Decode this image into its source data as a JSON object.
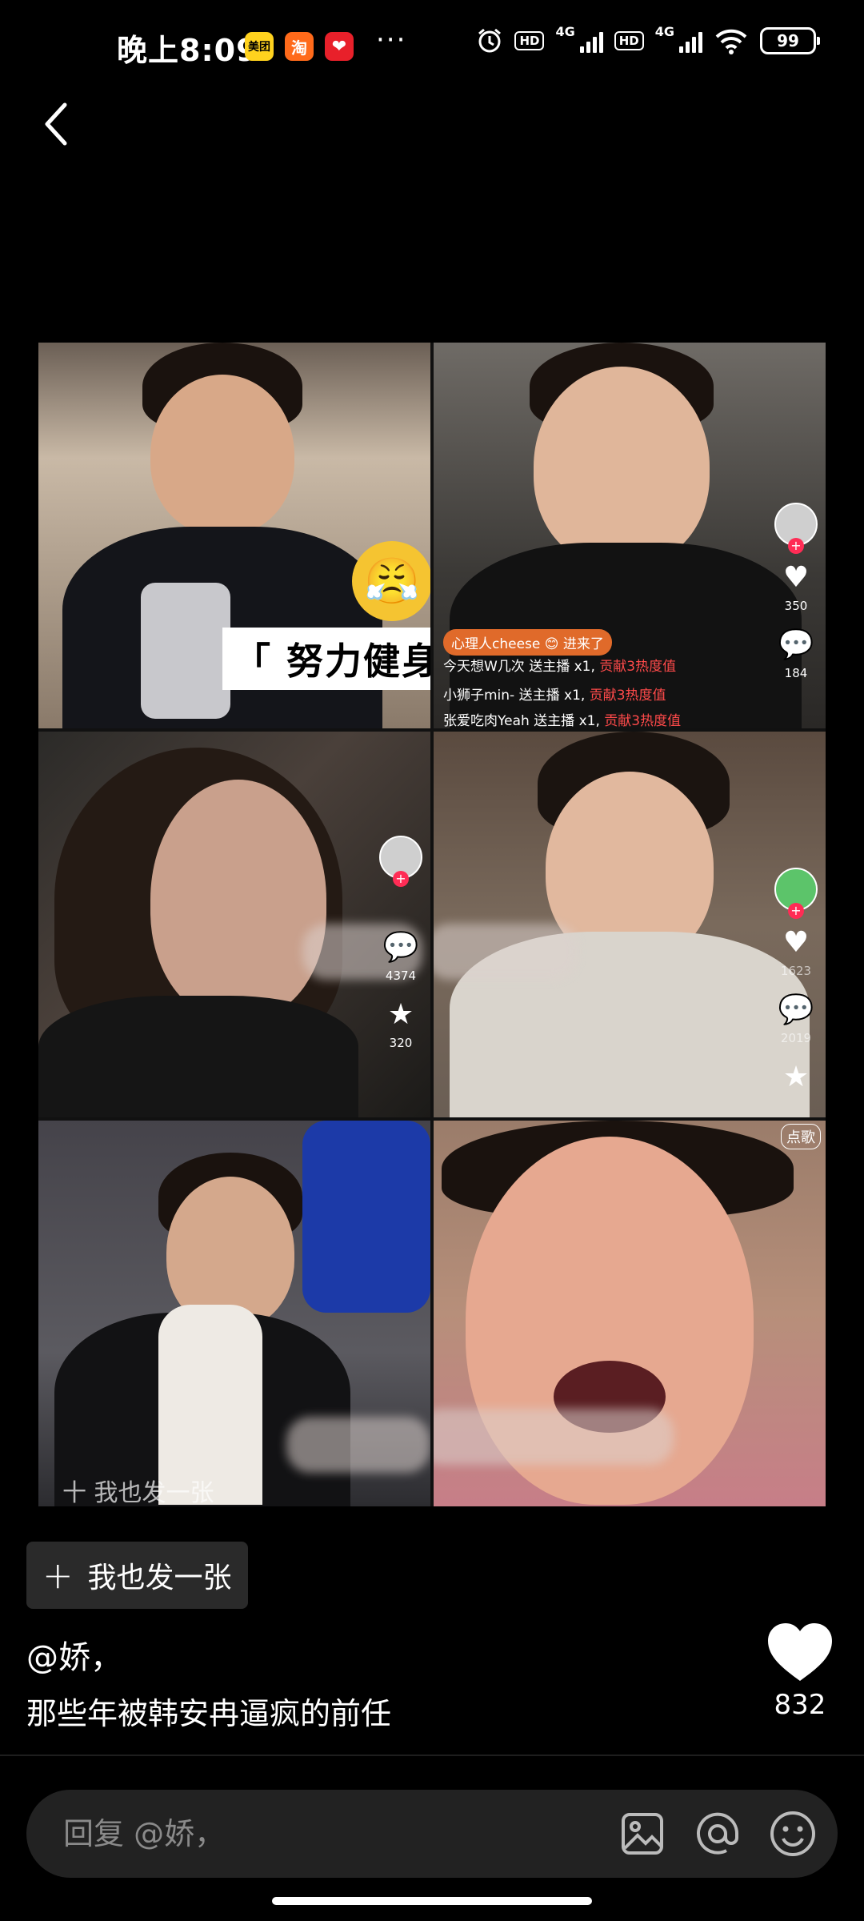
{
  "status_bar": {
    "time": "晚上8:09",
    "apps": [
      "美团",
      "淘",
      "❤"
    ],
    "more": "···",
    "hd_1": "HD",
    "net_1": "4G",
    "hd_2": "HD",
    "net_2": "4G",
    "battery": "99"
  },
  "header": {
    "back_icon": "chevron-left-icon"
  },
  "collage": {
    "tile1": {
      "caption": "「 努力健身 」",
      "emoji": "😤"
    },
    "tile2": {
      "join_text": "心理人cheese 😊 进来了",
      "comments": [
        {
          "user": "今天想W几次",
          "action": "送主播",
          "gift": "x1,",
          "contrib": "贡献3热度值"
        },
        {
          "user": "小狮子min-",
          "action": "送主播",
          "gift": "x1,",
          "contrib": "贡献3热度值"
        },
        {
          "user": "张爱吃肉Yeah",
          "action": "送主播",
          "gift": "x1,",
          "contrib": "贡献3热度值"
        }
      ],
      "likes": "350",
      "comment_count": "184"
    },
    "tile3": {
      "comment_count": "4374",
      "favorites": "320"
    },
    "tile4": {
      "likes": "1623",
      "comments": "2019"
    },
    "tile5": {
      "overlay_text": "十 我也发一张"
    },
    "tile6": {
      "tag": "点歌"
    }
  },
  "post": {
    "post_button_label": "我也发一张",
    "author": "@娇，",
    "caption": "那些年被韩安冉逼疯的前任",
    "like_count": "832"
  },
  "reply_bar": {
    "placeholder": "回复 @娇，",
    "icons": [
      "image-icon",
      "at-icon",
      "emoji-icon"
    ]
  },
  "colors": {
    "background": "#000000",
    "panel": "#222222",
    "accent_red": "#ff2c55"
  }
}
